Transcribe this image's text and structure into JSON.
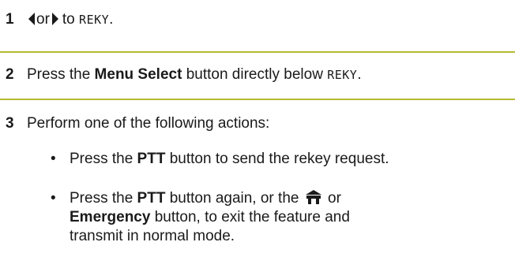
{
  "step1": {
    "number": "1",
    "or_text": "or",
    "to_text": "to",
    "menu_item": "REKY",
    "period": "."
  },
  "step2": {
    "number": "2",
    "before": "Press the ",
    "button_name": "Menu Select",
    "middle": " button directly below ",
    "menu_item": "REKY",
    "period": "."
  },
  "step3": {
    "number": "3",
    "intro": "Perform one of the following actions:",
    "bullets": [
      {
        "symbol": "•",
        "before": "Press the ",
        "button_name": "PTT",
        "after": " button to send the rekey request."
      },
      {
        "symbol": "•",
        "before": "Press the ",
        "button_name": "PTT",
        "middle": " button again, or the ",
        "or_text": " or",
        "button_name_2": "Emergency",
        "after_line2": " button, to exit the feature and",
        "line3": "transmit in normal mode."
      }
    ]
  },
  "colors": {
    "rule": "#b5bb33",
    "text": "#1a1a1a"
  },
  "icons": [
    "left-arrow-icon",
    "right-arrow-icon",
    "home-icon"
  ]
}
